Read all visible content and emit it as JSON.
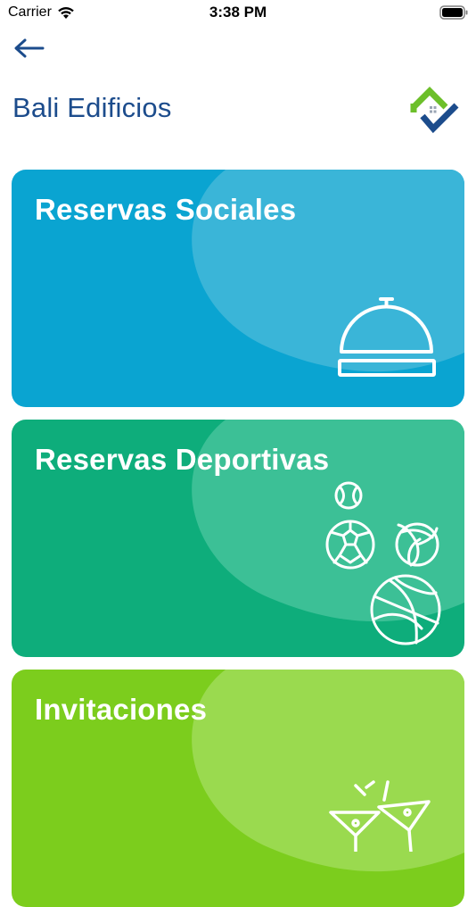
{
  "status_bar": {
    "carrier": "Carrier",
    "time": "3:38 PM"
  },
  "header": {
    "title": "Bali Edificios"
  },
  "cards": [
    {
      "label": "Reservas Sociales",
      "color": "#0aa4d1",
      "icon": "cloche-icon"
    },
    {
      "label": "Reservas Deportivas",
      "color": "#0ead7b",
      "icon": "sports-balls-icon"
    },
    {
      "label": "Invitaciones",
      "color": "#7ccd1d",
      "icon": "cocktail-glasses-icon"
    }
  ],
  "colors": {
    "title": "#1c4c8c",
    "logo_green": "#6cbf2a",
    "logo_blue": "#1c4c8c"
  }
}
